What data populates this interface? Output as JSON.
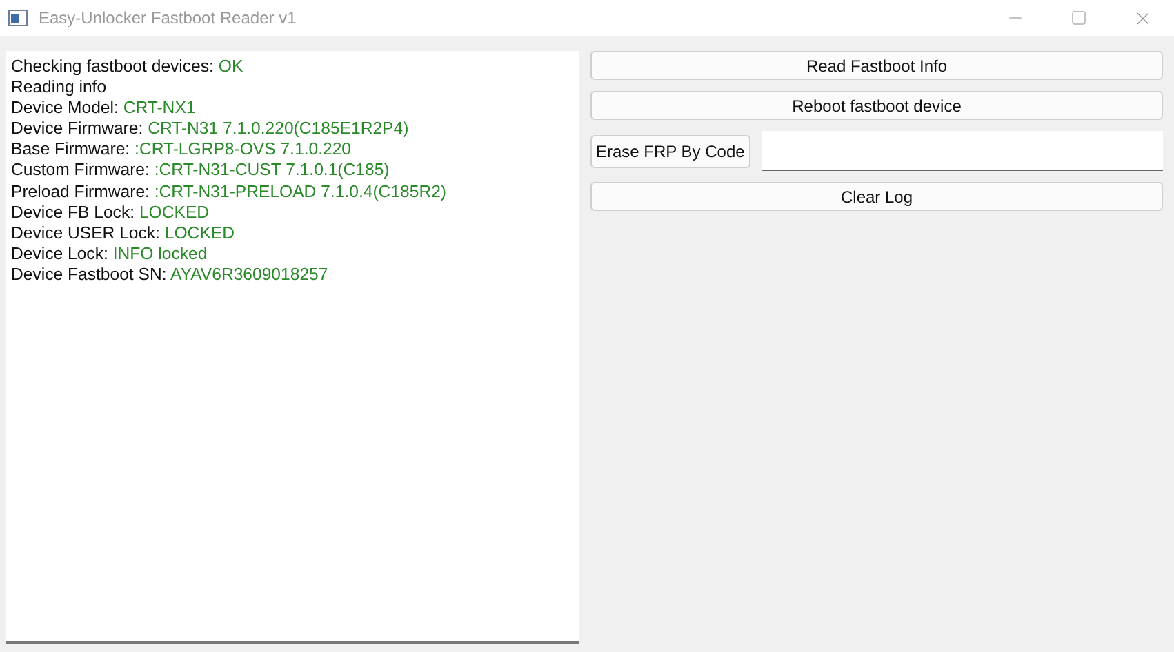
{
  "window": {
    "title": "Easy-Unlocker Fastboot Reader v1"
  },
  "log": [
    {
      "label": "Checking fastboot devices:",
      "value": "OK"
    },
    {
      "label": "Reading info"
    },
    {
      "label": "Device Model:",
      "value": "CRT-NX1"
    },
    {
      "label": "Device Firmware:",
      "value": "CRT-N31 7.1.0.220(C185E1R2P4)"
    },
    {
      "label": "Base Firmware:",
      "value": ":CRT-LGRP8-OVS 7.1.0.220"
    },
    {
      "label": "Custom Firmware:",
      "value": ":CRT-N31-CUST 7.1.0.1(C185)"
    },
    {
      "label": "Preload Firmware:",
      "value": ":CRT-N31-PRELOAD 7.1.0.4(C185R2)"
    },
    {
      "label": "Device FB Lock:",
      "value": "LOCKED"
    },
    {
      "label": "Device USER Lock:",
      "value": "LOCKED"
    },
    {
      "label": "Device Lock:",
      "value": "INFO locked"
    },
    {
      "label": "Device Fastboot SN:",
      "value": "AYAV6R3609018257"
    }
  ],
  "buttons": {
    "read": "Read Fastboot Info",
    "reboot": "Reboot fastboot device",
    "erase": "Erase FRP By Code",
    "clear": "Clear Log"
  }
}
